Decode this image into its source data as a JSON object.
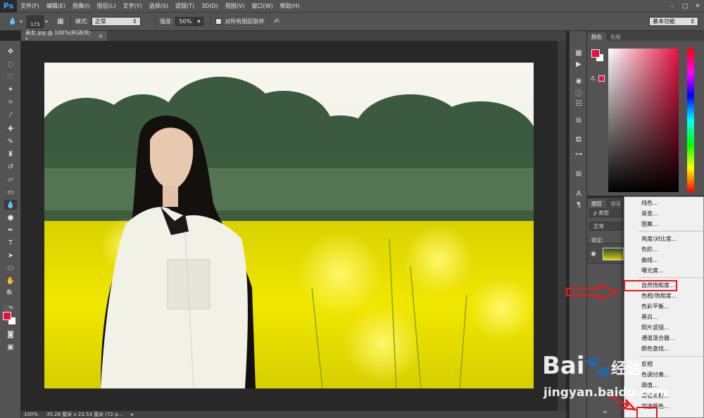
{
  "app": {
    "logo": "Ps"
  },
  "menubar": {
    "items": [
      "文件(F)",
      "编辑(E)",
      "图像(I)",
      "图层(L)",
      "文字(Y)",
      "选择(S)",
      "滤镜(T)",
      "3D(D)",
      "视图(V)",
      "窗口(W)",
      "帮助(H)"
    ],
    "window_controls": [
      "–",
      "□",
      "✕"
    ]
  },
  "options": {
    "brush_size": "175",
    "mode_label": "模式:",
    "mode_value": "正常",
    "strength_label": "强度:",
    "strength_value": "50%",
    "sample_all_label": "对所有图层取样",
    "workspace": "基本功能"
  },
  "document": {
    "tab_title": "美女.jpg @ 100%(RGB/8) *",
    "close": "×"
  },
  "status": {
    "zoom": "100%",
    "doc_info": "35.28 厘米 x 23.53 厘米 (72 p...",
    "arrow": "▸"
  },
  "color_panel": {
    "tabs": [
      "颜色",
      "色板"
    ]
  },
  "layers_panel": {
    "tabs": [
      "图层",
      "通道"
    ],
    "kind_filter": "ρ 类型",
    "blend_mode": "正常",
    "lock_label": "锁定:"
  },
  "adjust_menu": {
    "groups": [
      [
        "纯色...",
        "渐变...",
        "图案..."
      ],
      [
        "亮度/对比度...",
        "色阶...",
        "曲线...",
        "曝光度..."
      ],
      [
        "自然饱和度...",
        "色相/饱和度...",
        "色彩平衡...",
        "黑白...",
        "照片滤镜...",
        "通道混合器...",
        "颜色查找..."
      ],
      [
        "反相",
        "色调分离...",
        "阈值...",
        "渐变映射...",
        "可选颜色..."
      ]
    ],
    "highlighted": "自然饱和度..."
  },
  "watermark": {
    "brand": "Bai",
    "brand_suffix": "经验",
    "url": "jingyan.baidu.com"
  },
  "colors": {
    "foreground": "#e6113f",
    "highlight": "#e31b1b",
    "ui_gray": "#535353"
  }
}
